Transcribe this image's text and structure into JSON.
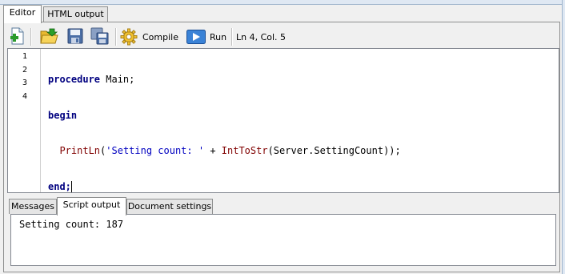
{
  "tabs": [
    "Editor",
    "HTML output"
  ],
  "toolbar": {
    "new_icon": "new-file-icon",
    "open_icon": "open-folder-icon",
    "save_icon": "save-icon",
    "save_all_icon": "save-all-icon",
    "compile_label": "Compile",
    "run_label": "Run",
    "status": "Ln 4, Col. 5"
  },
  "editor": {
    "line_numbers": [
      "1",
      "2",
      "3",
      "4"
    ],
    "line1": {
      "kw": "procedure",
      "rest": " Main;"
    },
    "line2": {
      "kw": "begin"
    },
    "line3": {
      "indent": "  ",
      "fn1": "PrintLn",
      "p1": "(",
      "str": "'Setting count: '",
      "p2": " + ",
      "fn2": "IntToStr",
      "p3": "(Server.SettingCount));"
    },
    "line4": {
      "kw": "end;"
    }
  },
  "bottom_tabs": [
    "Messages",
    "Script output",
    "Document settings"
  ],
  "output": {
    "text": "Setting count: 187"
  }
}
